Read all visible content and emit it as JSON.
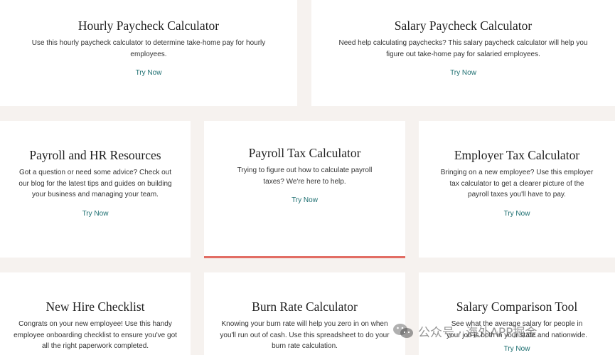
{
  "cards": {
    "hourly": {
      "title": "Hourly Paycheck Calculator",
      "desc": "Use this hourly paycheck calculator to determine take-home pay for hourly employees.",
      "link": "Try Now"
    },
    "salary": {
      "title": "Salary Paycheck Calculator",
      "desc": "Need help calculating paychecks? This salary paycheck calculator will help you figure out take-home pay for salaried employees.",
      "link": "Try Now"
    },
    "payroll_hr": {
      "title": "Payroll and HR Resources",
      "desc": "Got a question or need some advice? Check out our blog for the latest tips and guides on building your business and managing your team.",
      "link": "Try Now"
    },
    "payroll_tax": {
      "title": "Payroll Tax Calculator",
      "desc": "Trying to figure out how to calculate payroll taxes? We're here to help.",
      "link": "Try Now"
    },
    "employer_tax": {
      "title": "Employer Tax Calculator",
      "desc": "Bringing on a new employee? Use this employer tax calculator to get a clearer picture of the payroll taxes you'll have to pay.",
      "link": "Try Now"
    },
    "new_hire": {
      "title": "New Hire Checklist",
      "desc": "Congrats on your new employee! Use this handy employee onboarding checklist to ensure you've got all the right paperwork completed."
    },
    "burn_rate": {
      "title": "Burn Rate Calculator",
      "desc": "Knowing your burn rate will help you zero in on when you'll run out of cash. Use this spreadsheet to do your burn rate calculation."
    },
    "salary_comparison": {
      "title": "Salary Comparison Tool",
      "desc": "See what the average salary for people in your job is both in your state and nationwide.",
      "link": "Try Now"
    }
  },
  "watermark": {
    "text": "公众号 · 海外APP掘金"
  },
  "colors": {
    "accent": "#e26d64",
    "link": "#1c6e70",
    "background": "#f6f2ef"
  }
}
